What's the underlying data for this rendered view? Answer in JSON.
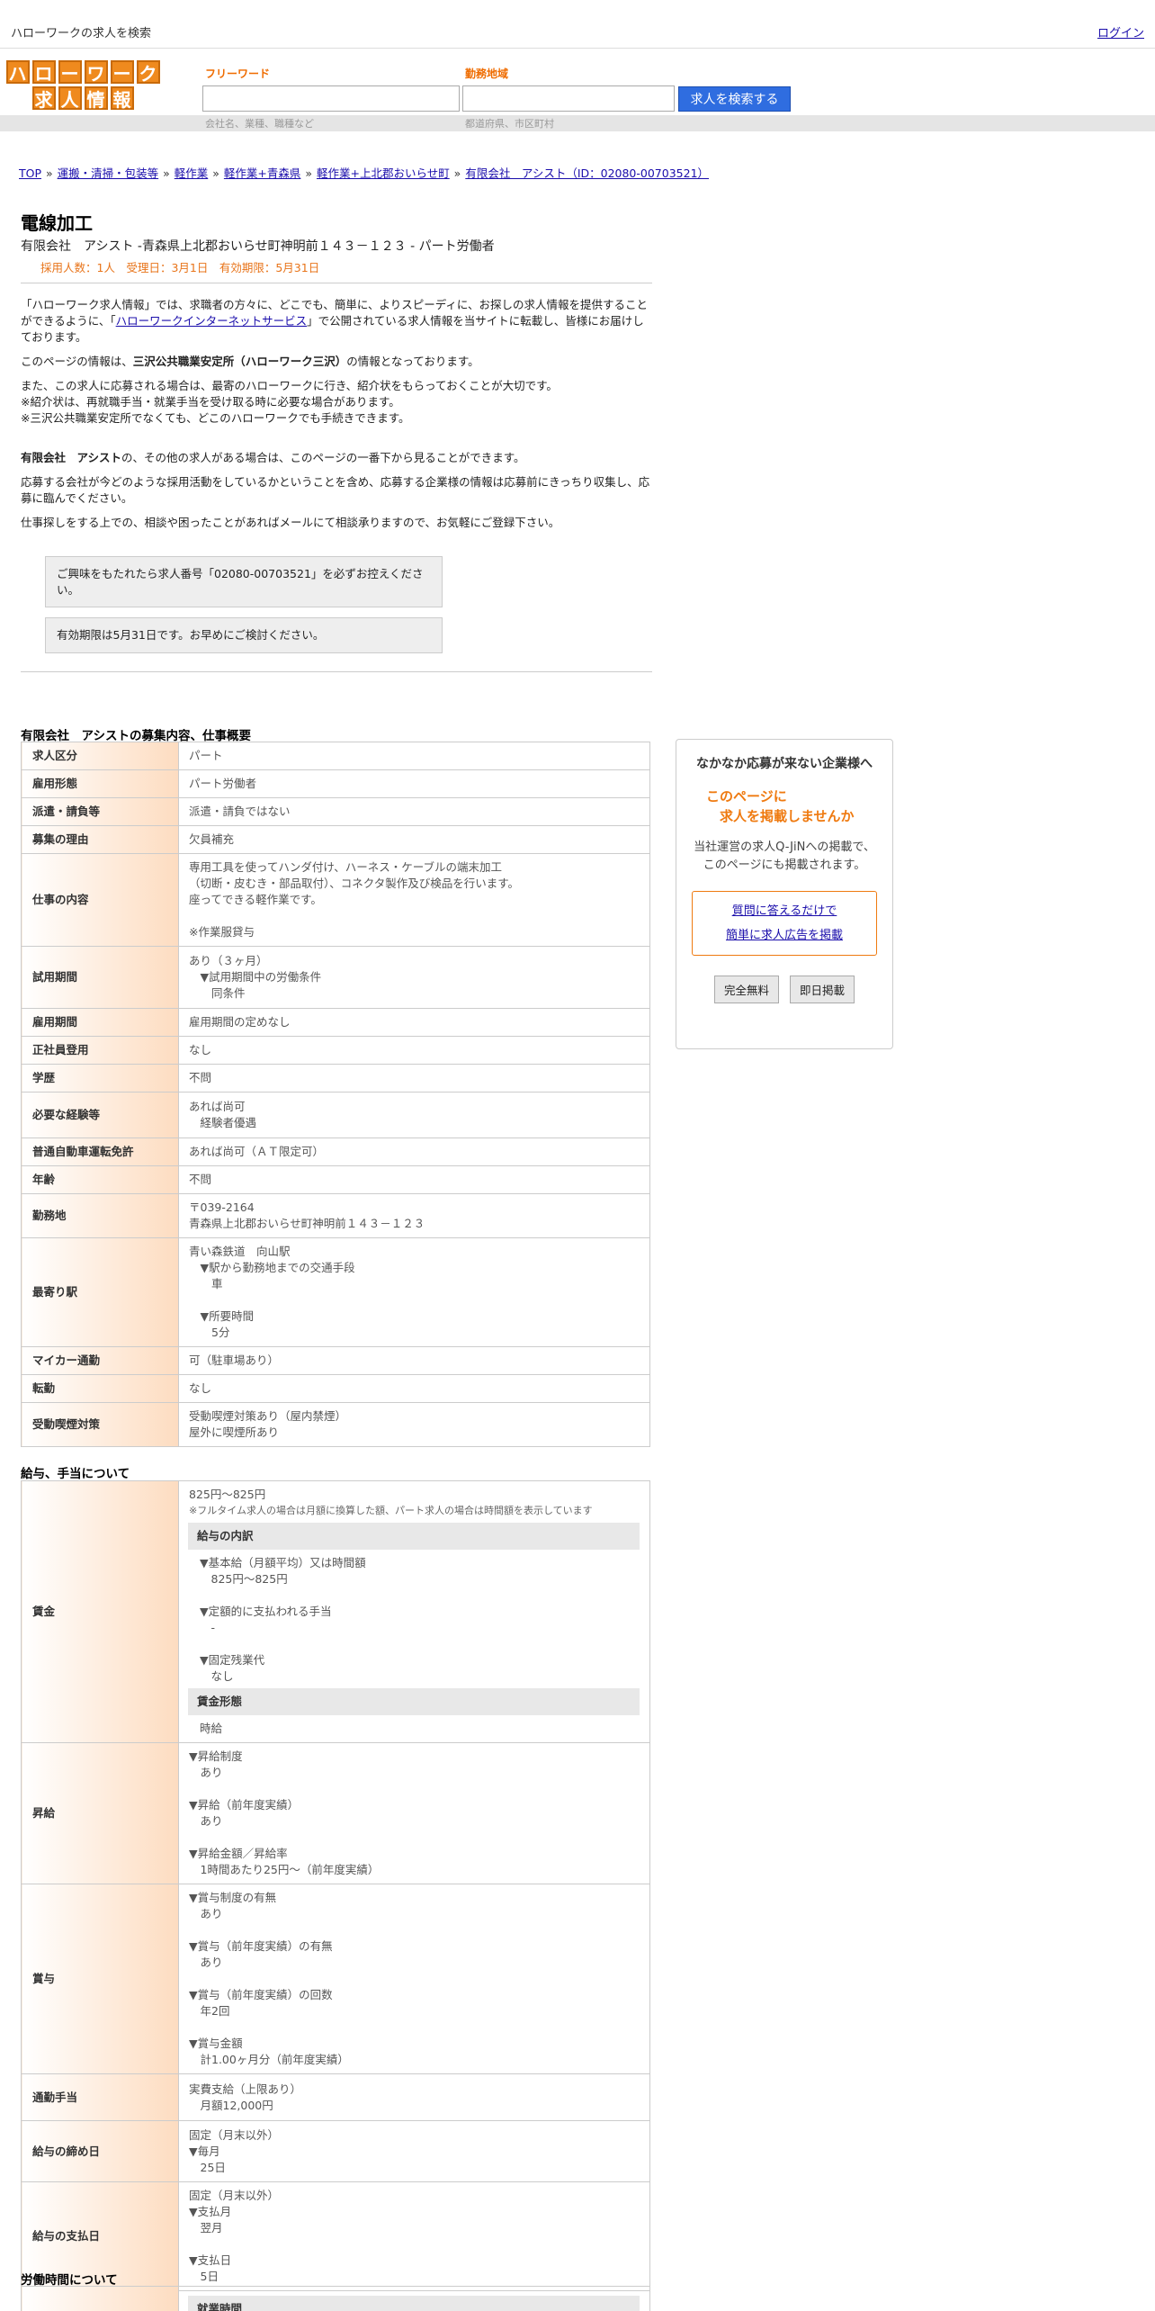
{
  "site_title": "ハローワークの求人を検索",
  "login": "ログイン",
  "logo": {
    "row1": [
      "ハ",
      "ロ",
      "ー",
      "ワ",
      "ー",
      "ク"
    ],
    "row2": [
      "求",
      "人",
      "情",
      "報"
    ]
  },
  "search": {
    "freeword_label": "フリーワード",
    "freeword_hint": "会社名、業種、職種など",
    "area_label": "勤務地域",
    "area_hint": "都道府県、市区町村",
    "button": "求人を検索する"
  },
  "breadcrumb": {
    "links": [
      "TOP",
      "運搬・清掃・包装等",
      "軽作業",
      "軽作業+青森県",
      "軽作業+上北郡おいらせ町",
      "有限会社　アシスト（ID：02080-00703521）"
    ],
    "sep": " » "
  },
  "job": {
    "title": "電線加工",
    "subtitle": "有限会社　アシスト -青森県上北郡おいらせ町神明前１４３－１２３ - パート労働者",
    "meta": "採用人数：1人　受理日：3月1日　有効期限：5月31日"
  },
  "intro": {
    "p1a": "「ハローワーク求人情報」では、求職者の方々に、どこでも、簡単に、よりスピーディに、お探しの求人情報を提供することができるように、「",
    "p1_link": "ハローワークインターネットサービス",
    "p1b": "」で公開されている求人情報を当サイトに転載し、皆様にお届けしております。",
    "p2a": "このページの情報は、",
    "p2_bold": "三沢公共職業安定所（ハローワーク三沢）",
    "p2b": "の情報となっております。",
    "p3_1": "また、この求人に応募される場合は、最寄のハローワークに行き、紹介状をもらっておくことが大切です。",
    "p3_2": "※紹介状は、再就職手当・就業手当を受け取る時に必要な場合があります。",
    "p3_3": "※三沢公共職業安定所でなくても、どこのハローワークでも手続きできます。",
    "p4_bold": "有限会社　アシスト",
    "p4": "の、その他の求人がある場合は、このページの一番下から見ることができます。",
    "p5": "応募する会社が今どのような採用活動をしているかということを含め、応募する企業様の情報は応募前にきっちり収集し、応募に臨んでください。",
    "p6": "仕事探しをする上での、相談や困ったことがあればメールにて相談承りますので、お気軽にご登録下さい。"
  },
  "notices": [
    "ご興味をもたれたら求人番号「02080-00703521」を必ずお控えください。",
    "有効期限は5月31日です。お早めにご検討ください。"
  ],
  "section1": {
    "title": "有限会社　アシストの募集内容、仕事概要",
    "rows": [
      {
        "k": "求人区分",
        "v": [
          "パート"
        ]
      },
      {
        "k": "雇用形態",
        "v": [
          "パート労働者"
        ]
      },
      {
        "k": "派遣・請負等",
        "v": [
          "派遣・請負ではない"
        ]
      },
      {
        "k": "募集の理由",
        "v": [
          "欠員補充"
        ]
      },
      {
        "k": "仕事の内容",
        "v": [
          "専用工具を使ってハンダ付け、ハーネス・ケーブルの端末加工",
          "（切断・皮むき・部品取付）、コネクタ製作及び検品を行います。",
          "座ってできる軽作業です。",
          "",
          "※作業服貸与"
        ]
      },
      {
        "k": "試用期間",
        "v": [
          "あり（３ヶ月）",
          "　▼試用期間中の労働条件",
          "　　同条件"
        ]
      },
      {
        "k": "雇用期間",
        "v": [
          "雇用期間の定めなし"
        ]
      },
      {
        "k": "正社員登用",
        "v": [
          "なし"
        ]
      },
      {
        "k": "学歴",
        "v": [
          "不問"
        ]
      },
      {
        "k": "必要な経験等",
        "v": [
          "あれば尚可",
          "　経験者優遇"
        ]
      },
      {
        "k": "普通自動車運転免許",
        "v": [
          "あれば尚可（ＡＴ限定可）"
        ]
      },
      {
        "k": "年齢",
        "v": [
          "不問"
        ]
      },
      {
        "k": "勤務地",
        "v": [
          "〒039-2164",
          "青森県上北郡おいらせ町神明前１４３－１２３"
        ]
      },
      {
        "k": "最寄り駅",
        "v": [
          "青い森鉄道　向山駅",
          "　▼駅から勤務地までの交通手段",
          "　　車",
          "",
          "　▼所要時間",
          "　　5分"
        ]
      },
      {
        "k": "マイカー通勤",
        "v": [
          "可（駐車場あり）"
        ]
      },
      {
        "k": "転勤",
        "v": [
          "なし"
        ]
      },
      {
        "k": "受動喫煙対策",
        "v": [
          "受動喫煙対策あり（屋内禁煙）",
          "屋外に喫煙所あり"
        ]
      }
    ]
  },
  "section2": {
    "title": "給与、手当について",
    "wage": {
      "k": "賃金",
      "line1": "825円〜825円",
      "note": "※フルタイム求人の場合は月額に換算した額、パート求人の場合は時間額を表示しています",
      "breakdown_head": "給与の内訳",
      "breakdown": [
        "▼基本給（月額平均）又は時間額",
        "　825円〜825円",
        "",
        "▼定額的に支払われる手当",
        "　-",
        "",
        "▼固定残業代",
        "　なし"
      ],
      "form_head": "賃金形態",
      "form": "時給"
    },
    "rows": [
      {
        "k": "昇給",
        "v": [
          "▼昇給制度",
          "　あり",
          "",
          "▼昇給（前年度実績）",
          "　あり",
          "",
          "▼昇給金額／昇給率",
          "　1時間あたり25円〜（前年度実績）"
        ]
      },
      {
        "k": "賞与",
        "v": [
          "▼賞与制度の有無",
          "　あり",
          "",
          "▼賞与（前年度実績）の有無",
          "　あり",
          "",
          "▼賞与（前年度実績）の回数",
          "　年2回",
          "",
          "▼賞与金額",
          "　計1.00ヶ月分（前年度実績）"
        ]
      },
      {
        "k": "通勤手当",
        "v": [
          "実費支給（上限あり）",
          "　月額12,000円"
        ]
      },
      {
        "k": "給与の締め日",
        "v": [
          "固定（月末以外）",
          "▼毎月",
          "　25日"
        ]
      },
      {
        "k": "給与の支払日",
        "v": [
          "固定（月末以外）",
          "▼支払月",
          "　翌月",
          "",
          "▼支払日",
          "　5日"
        ]
      }
    ]
  },
  "section3": {
    "title": "労働時間について",
    "sub": "就業時間"
  },
  "sidebox": {
    "title": "なかなか応募が来ない企業様へ",
    "catch1": "このページに",
    "catch2": "　求人を掲載しませんか",
    "body1": "当社運営の求人Q-JiNへの掲載で、",
    "body2": "このページにも掲載されます。",
    "link1": "質問に答えるだけで",
    "link2": "簡単に求人広告を掲載",
    "btn1": "完全無料",
    "btn2": "即日掲載"
  }
}
